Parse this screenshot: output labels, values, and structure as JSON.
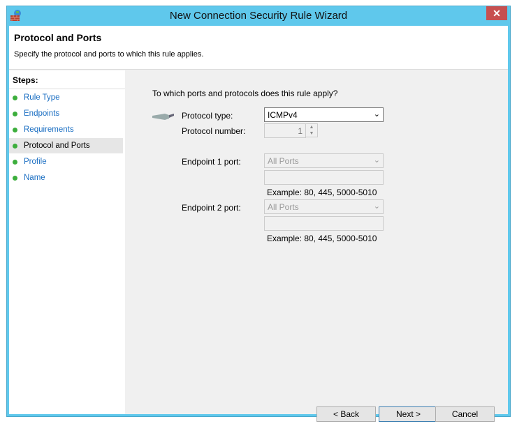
{
  "window": {
    "title": "New Connection Security Rule Wizard",
    "close": "✕"
  },
  "header": {
    "title": "Protocol and Ports",
    "subtitle": "Specify the protocol and ports to which this rule applies."
  },
  "steps": {
    "heading": "Steps:",
    "items": [
      {
        "label": "Rule Type"
      },
      {
        "label": "Endpoints"
      },
      {
        "label": "Requirements"
      },
      {
        "label": "Protocol and Ports",
        "current": true
      },
      {
        "label": "Profile"
      },
      {
        "label": "Name"
      }
    ]
  },
  "main": {
    "question": "To which ports and protocols does this rule apply?",
    "protocol_type_label": "Protocol type:",
    "protocol_type_value": "ICMPv4",
    "protocol_number_label": "Protocol number:",
    "protocol_number_value": "1",
    "ep1_label": "Endpoint 1 port:",
    "ep1_value": "All Ports",
    "ep1_input": "",
    "ep1_example": "Example: 80, 445, 5000-5010",
    "ep2_label": "Endpoint 2 port:",
    "ep2_value": "All Ports",
    "ep2_input": "",
    "ep2_example": "Example: 80, 445, 5000-5010"
  },
  "buttons": {
    "back": "< Back",
    "next": "Next >",
    "cancel": "Cancel"
  }
}
